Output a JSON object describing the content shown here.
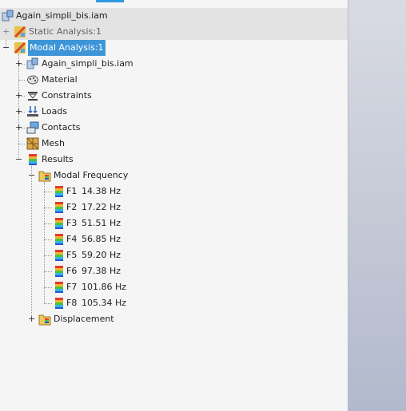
{
  "tree": {
    "root": {
      "label": "Again_simpli_bis.iam",
      "icon": "assembly-icon"
    },
    "static_analysis": {
      "label": "Static Analysis:1",
      "icon": "analysis-icon"
    },
    "modal_analysis": {
      "label": "Modal Analysis:1",
      "icon": "analysis-icon",
      "selected": true
    },
    "children": [
      {
        "label": "Again_simpli_bis.iam",
        "icon": "assembly-icon"
      },
      {
        "label": "Material",
        "icon": "material-icon"
      },
      {
        "label": "Constraints",
        "icon": "constraints-icon"
      },
      {
        "label": "Loads",
        "icon": "loads-icon"
      },
      {
        "label": "Contacts",
        "icon": "contacts-icon"
      },
      {
        "label": "Mesh",
        "icon": "mesh-icon"
      },
      {
        "label": "Results",
        "icon": "results-icon"
      }
    ],
    "modal_frequency": {
      "label": "Modal Frequency",
      "icon": "folder-results-icon"
    },
    "frequencies": [
      {
        "name": "F1",
        "value": "14.38 Hz"
      },
      {
        "name": "F2",
        "value": "17.22 Hz"
      },
      {
        "name": "F3",
        "value": "51.51 Hz"
      },
      {
        "name": "F4",
        "value": "56.85 Hz"
      },
      {
        "name": "F5",
        "value": "59.20 Hz"
      },
      {
        "name": "F6",
        "value": "97.38 Hz"
      },
      {
        "name": "F7",
        "value": "101.86 Hz"
      },
      {
        "name": "F8",
        "value": "105.34 Hz"
      }
    ],
    "displacement": {
      "label": "Displacement",
      "icon": "folder-results-icon"
    }
  },
  "colors": {
    "selection": "#3d95d8",
    "band": "#e3e3e3",
    "canvas_top": "#d8dbe2",
    "canvas_bottom": "#b2b9cd"
  }
}
